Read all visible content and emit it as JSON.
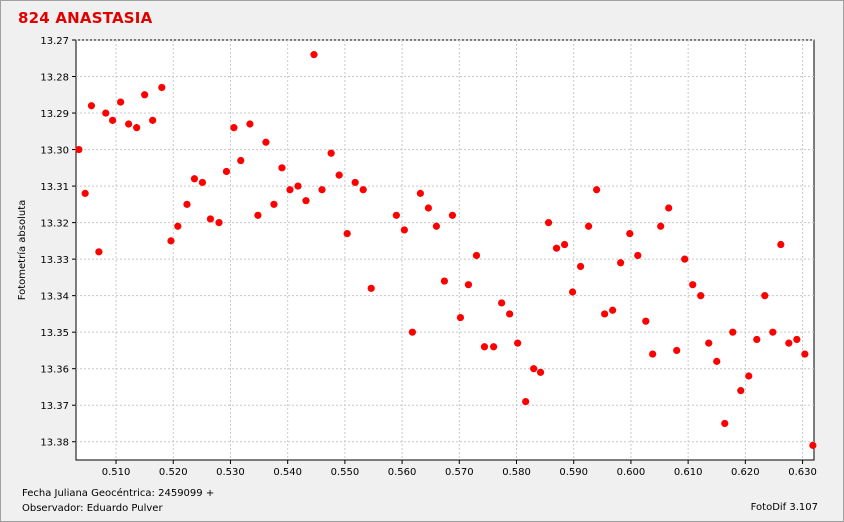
{
  "chart_data": {
    "type": "scatter",
    "title": "824 ANASTASIA",
    "ylabel": "Fotometría absoluta",
    "xlabel": "Fecha Juliana Geocéntrica: 2459099 +",
    "observer": "Observador: Eduardo Pulver",
    "software": "FotoDif 3.107",
    "xlim": [
      0.503,
      0.632
    ],
    "ylim": [
      13.27,
      13.385
    ],
    "y_inverted": true,
    "grid": true,
    "marker_color": "#ff0000",
    "x_ticks": [
      "0.510",
      "0.520",
      "0.530",
      "0.540",
      "0.550",
      "0.560",
      "0.570",
      "0.580",
      "0.590",
      "0.600",
      "0.610",
      "0.620",
      "0.630"
    ],
    "y_ticks": [
      "13.27",
      "13.28",
      "13.29",
      "13.30",
      "13.31",
      "13.32",
      "13.33",
      "13.34",
      "13.35",
      "13.36",
      "13.37",
      "13.38"
    ],
    "points": [
      [
        0.5035,
        13.3
      ],
      [
        0.5046,
        13.312
      ],
      [
        0.5057,
        13.288
      ],
      [
        0.507,
        13.328
      ],
      [
        0.5082,
        13.29
      ],
      [
        0.5094,
        13.292
      ],
      [
        0.5108,
        13.287
      ],
      [
        0.5122,
        13.293
      ],
      [
        0.5136,
        13.294
      ],
      [
        0.515,
        13.285
      ],
      [
        0.5164,
        13.292
      ],
      [
        0.518,
        13.283
      ],
      [
        0.5196,
        13.325
      ],
      [
        0.5208,
        13.321
      ],
      [
        0.5224,
        13.315
      ],
      [
        0.5237,
        13.308
      ],
      [
        0.5251,
        13.309
      ],
      [
        0.5265,
        13.319
      ],
      [
        0.528,
        13.32
      ],
      [
        0.5293,
        13.306
      ],
      [
        0.5306,
        13.294
      ],
      [
        0.5318,
        13.303
      ],
      [
        0.5334,
        13.293
      ],
      [
        0.5348,
        13.318
      ],
      [
        0.5362,
        13.298
      ],
      [
        0.5376,
        13.315
      ],
      [
        0.539,
        13.305
      ],
      [
        0.5404,
        13.311
      ],
      [
        0.5418,
        13.31
      ],
      [
        0.5432,
        13.314
      ],
      [
        0.5446,
        13.274
      ],
      [
        0.546,
        13.311
      ],
      [
        0.5476,
        13.301
      ],
      [
        0.549,
        13.307
      ],
      [
        0.5504,
        13.323
      ],
      [
        0.5518,
        13.309
      ],
      [
        0.5532,
        13.311
      ],
      [
        0.5546,
        13.338
      ],
      [
        0.559,
        13.318
      ],
      [
        0.5604,
        13.322
      ],
      [
        0.5618,
        13.35
      ],
      [
        0.5632,
        13.312
      ],
      [
        0.5646,
        13.316
      ],
      [
        0.566,
        13.321
      ],
      [
        0.5674,
        13.336
      ],
      [
        0.5688,
        13.318
      ],
      [
        0.5702,
        13.346
      ],
      [
        0.5716,
        13.337
      ],
      [
        0.573,
        13.329
      ],
      [
        0.5744,
        13.354
      ],
      [
        0.576,
        13.354
      ],
      [
        0.5774,
        13.342
      ],
      [
        0.5788,
        13.345
      ],
      [
        0.5802,
        13.353
      ],
      [
        0.5816,
        13.369
      ],
      [
        0.583,
        13.36
      ],
      [
        0.5842,
        13.361
      ],
      [
        0.5856,
        13.32
      ],
      [
        0.587,
        13.327
      ],
      [
        0.5884,
        13.326
      ],
      [
        0.5898,
        13.339
      ],
      [
        0.5912,
        13.332
      ],
      [
        0.5926,
        13.321
      ],
      [
        0.594,
        13.311
      ],
      [
        0.5954,
        13.345
      ],
      [
        0.5968,
        13.344
      ],
      [
        0.5982,
        13.331
      ],
      [
        0.5998,
        13.323
      ],
      [
        0.6012,
        13.329
      ],
      [
        0.6026,
        13.347
      ],
      [
        0.6038,
        13.356
      ],
      [
        0.6052,
        13.321
      ],
      [
        0.6066,
        13.316
      ],
      [
        0.608,
        13.355
      ],
      [
        0.6094,
        13.33
      ],
      [
        0.6108,
        13.337
      ],
      [
        0.6122,
        13.34
      ],
      [
        0.6136,
        13.353
      ],
      [
        0.615,
        13.358
      ],
      [
        0.6164,
        13.375
      ],
      [
        0.6178,
        13.35
      ],
      [
        0.6192,
        13.366
      ],
      [
        0.6206,
        13.362
      ],
      [
        0.622,
        13.352
      ],
      [
        0.6234,
        13.34
      ],
      [
        0.6248,
        13.35
      ],
      [
        0.6262,
        13.326
      ],
      [
        0.6276,
        13.353
      ],
      [
        0.629,
        13.352
      ],
      [
        0.6304,
        13.356
      ],
      [
        0.6318,
        13.381
      ]
    ]
  }
}
